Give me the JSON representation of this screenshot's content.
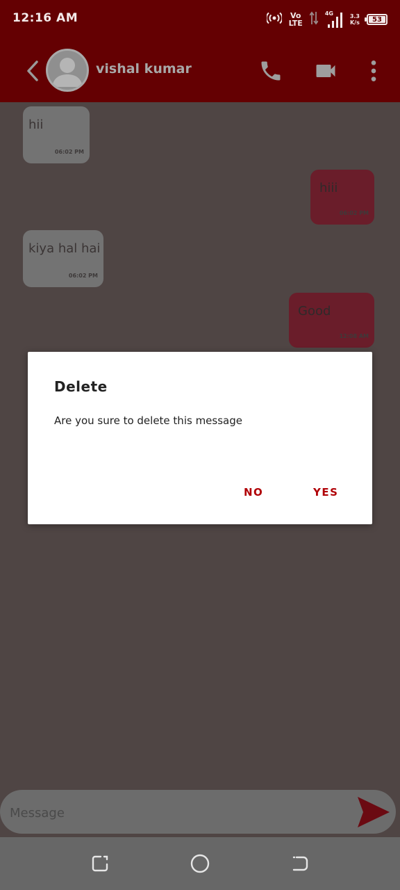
{
  "status_bar": {
    "time": "12:16 AM",
    "volte_top": "Vo",
    "volte_bottom": "LTE",
    "network": "4G",
    "speed_top": "3.3",
    "speed_bottom": "K/s",
    "battery": "53"
  },
  "header": {
    "contact_name": "vishal kumar",
    "icons": [
      "back-arrow-icon",
      "avatar",
      "phone-icon",
      "video-call-icon",
      "more-vert-icon"
    ]
  },
  "messages": [
    {
      "direction": "incoming",
      "text": "hii",
      "time": "06:02 PM"
    },
    {
      "direction": "outgoing",
      "text": "hiii",
      "time": "06:02 PM"
    },
    {
      "direction": "incoming",
      "text": "kiya hal hai",
      "time": "06:02 PM"
    },
    {
      "direction": "outgoing",
      "text": "Good",
      "time": "12:08 AM"
    }
  ],
  "dialog": {
    "title": "Delete",
    "message": "Are you sure to delete this message",
    "no_label": "NO",
    "yes_label": "YES"
  },
  "composer": {
    "placeholder": "Message"
  },
  "colors": {
    "header_red_dimmed": "#640002",
    "dialog_accent": "#b00006",
    "scrim_background": "#4f4544"
  }
}
